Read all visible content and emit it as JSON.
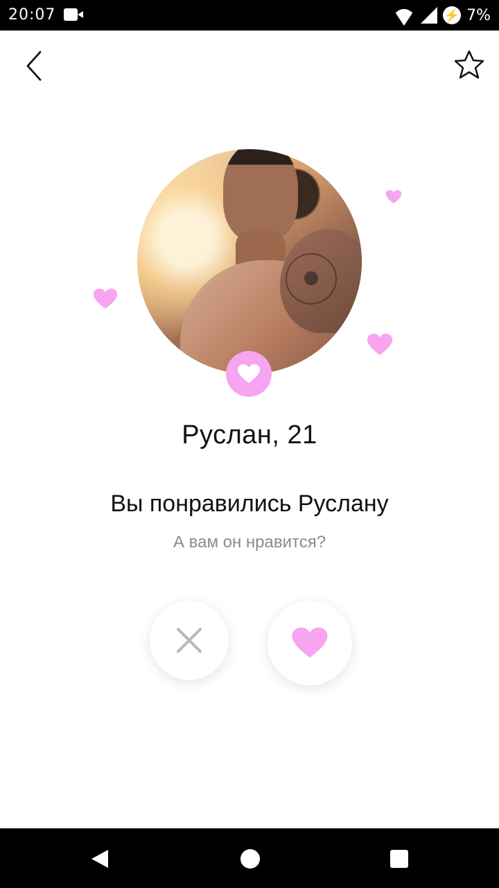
{
  "status_bar": {
    "time": "20:07",
    "battery": "7%"
  },
  "header": {
    "back_icon": "chevron-left-icon",
    "favorite_icon": "star-outline-icon"
  },
  "profile": {
    "name_age": "Руслан, 21"
  },
  "match": {
    "title": "Вы понравились Руслану",
    "question": "А вам он нравится?"
  },
  "actions": {
    "dislike_icon": "close-icon",
    "like_icon": "heart-icon",
    "accent_color": "#f7a5f0",
    "dislike_color": "#b8b8b8"
  },
  "navigation": {
    "back_icon": "triangle-back-icon",
    "home_icon": "circle-home-icon",
    "recent_icon": "square-recent-icon"
  }
}
